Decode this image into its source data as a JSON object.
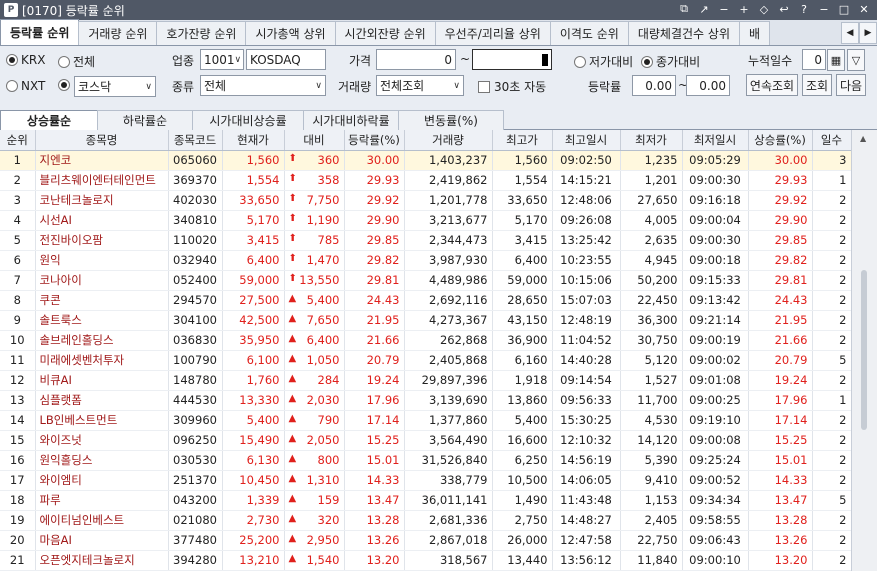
{
  "window": {
    "title": "[0170] 등락률 순위",
    "logo": "P"
  },
  "title_controls": [
    "⧉",
    "↗",
    "−",
    "+",
    "◇",
    "↩",
    "?",
    "−",
    "□",
    "✕"
  ],
  "tabs": [
    {
      "label": "등락률 순위",
      "active": true
    },
    {
      "label": "거래량 순위"
    },
    {
      "label": "호가잔량 순위"
    },
    {
      "label": "시가총액 상위"
    },
    {
      "label": "시간외잔량 순위"
    },
    {
      "label": "우선주/괴리율 상위"
    },
    {
      "label": "이격도 순위"
    },
    {
      "label": "대량체결건수 상위"
    },
    {
      "label": "배"
    }
  ],
  "tab_nav": [
    "◀",
    "▶"
  ],
  "controls": {
    "market_krx": "KRX",
    "market_nxt": "NXT",
    "scope_all": "전체",
    "market_select": "코스닥",
    "sector_label": "업종",
    "sector_code": "1001",
    "sector_name": "KOSDAQ",
    "type_label": "종류",
    "type_value": "전체",
    "price_label": "가격",
    "price_from": "0",
    "tilde": "~",
    "volume_label": "거래량",
    "volume_value": "전체조회",
    "auto30": "30초 자동",
    "vs_low": "저가대비",
    "vs_close": "종가대비",
    "rate_label": "등락률",
    "rate_from": "0.00",
    "rate_to": "0.00",
    "days_label": "누적일수",
    "days_value": "0",
    "btn_continuous": "연속조회",
    "btn_query": "조회",
    "btn_next": "다음"
  },
  "subtabs": [
    "상승률순",
    "하락률순",
    "시가대비상승률",
    "시가대비하락률",
    "변동률(%)"
  ],
  "columns": [
    "순위",
    "종목명",
    "종목코드",
    "현재가",
    "대비",
    "등락률(%)",
    "거래량",
    "최고가",
    "최고일시",
    "최저가",
    "최저일시",
    "상승률(%)",
    "일수"
  ],
  "rows": [
    {
      "rank": "1",
      "name": "지엔코",
      "code": "065060",
      "price": "1,560",
      "arrow": "⬆",
      "chg": "360",
      "rate": "30.00",
      "vol": "1,403,237",
      "high": "1,560",
      "hight": "09:02:50",
      "low": "1,235",
      "lowt": "09:05:29",
      "up": "30.00",
      "days": "3"
    },
    {
      "rank": "2",
      "name": "블리츠웨이엔터테인먼트",
      "code": "369370",
      "price": "1,554",
      "arrow": "⬆",
      "chg": "358",
      "rate": "29.93",
      "vol": "2,419,862",
      "high": "1,554",
      "hight": "14:15:21",
      "low": "1,201",
      "lowt": "09:00:30",
      "up": "29.93",
      "days": "1"
    },
    {
      "rank": "3",
      "name": "코난테크놀로지",
      "code": "402030",
      "price": "33,650",
      "arrow": "⬆",
      "chg": "7,750",
      "rate": "29.92",
      "vol": "1,201,778",
      "high": "33,650",
      "hight": "12:48:06",
      "low": "27,650",
      "lowt": "09:16:18",
      "up": "29.92",
      "days": "2"
    },
    {
      "rank": "4",
      "name": "시선AI",
      "code": "340810",
      "price": "5,170",
      "arrow": "⬆",
      "chg": "1,190",
      "rate": "29.90",
      "vol": "3,213,677",
      "high": "5,170",
      "hight": "09:26:08",
      "low": "4,005",
      "lowt": "09:00:04",
      "up": "29.90",
      "days": "2"
    },
    {
      "rank": "5",
      "name": "전진바이오팜",
      "code": "110020",
      "price": "3,415",
      "arrow": "⬆",
      "chg": "785",
      "rate": "29.85",
      "vol": "2,344,473",
      "high": "3,415",
      "hight": "13:25:42",
      "low": "2,635",
      "lowt": "09:00:30",
      "up": "29.85",
      "days": "2"
    },
    {
      "rank": "6",
      "name": "원익",
      "code": "032940",
      "price": "6,400",
      "arrow": "⬆",
      "chg": "1,470",
      "rate": "29.82",
      "vol": "3,987,930",
      "high": "6,400",
      "hight": "10:23:55",
      "low": "4,945",
      "lowt": "09:00:18",
      "up": "29.82",
      "days": "2"
    },
    {
      "rank": "7",
      "name": "코나아이",
      "code": "052400",
      "price": "59,000",
      "arrow": "⬆",
      "chg": "13,550",
      "rate": "29.81",
      "vol": "4,489,986",
      "high": "59,000",
      "hight": "10:15:06",
      "low": "50,200",
      "lowt": "09:15:33",
      "up": "29.81",
      "days": "2"
    },
    {
      "rank": "8",
      "name": "쿠콘",
      "code": "294570",
      "price": "27,500",
      "arrow": "▲",
      "chg": "5,400",
      "rate": "24.43",
      "vol": "2,692,116",
      "high": "28,650",
      "hight": "15:07:03",
      "low": "22,450",
      "lowt": "09:13:42",
      "up": "24.43",
      "days": "2"
    },
    {
      "rank": "9",
      "name": "솔트룩스",
      "code": "304100",
      "price": "42,500",
      "arrow": "▲",
      "chg": "7,650",
      "rate": "21.95",
      "vol": "4,273,367",
      "high": "43,150",
      "hight": "12:48:19",
      "low": "36,300",
      "lowt": "09:21:14",
      "up": "21.95",
      "days": "2"
    },
    {
      "rank": "10",
      "name": "솔브레인홀딩스",
      "code": "036830",
      "price": "35,950",
      "arrow": "▲",
      "chg": "6,400",
      "rate": "21.66",
      "vol": "262,868",
      "high": "36,900",
      "hight": "11:04:52",
      "low": "30,750",
      "lowt": "09:00:19",
      "up": "21.66",
      "days": "2"
    },
    {
      "rank": "11",
      "name": "미래에셋벤처투자",
      "code": "100790",
      "price": "6,100",
      "arrow": "▲",
      "chg": "1,050",
      "rate": "20.79",
      "vol": "2,405,868",
      "high": "6,160",
      "hight": "14:40:28",
      "low": "5,120",
      "lowt": "09:00:02",
      "up": "20.79",
      "days": "5"
    },
    {
      "rank": "12",
      "name": "비큐AI",
      "code": "148780",
      "price": "1,760",
      "arrow": "▲",
      "chg": "284",
      "rate": "19.24",
      "vol": "29,897,396",
      "high": "1,918",
      "hight": "09:14:54",
      "low": "1,527",
      "lowt": "09:01:08",
      "up": "19.24",
      "days": "2"
    },
    {
      "rank": "13",
      "name": "심플랫폼",
      "code": "444530",
      "price": "13,330",
      "arrow": "▲",
      "chg": "2,030",
      "rate": "17.96",
      "vol": "3,139,690",
      "high": "13,860",
      "hight": "09:56:33",
      "low": "11,700",
      "lowt": "09:00:25",
      "up": "17.96",
      "days": "1"
    },
    {
      "rank": "14",
      "name": "LB인베스트먼트",
      "code": "309960",
      "price": "5,400",
      "arrow": "▲",
      "chg": "790",
      "rate": "17.14",
      "vol": "1,377,860",
      "high": "5,400",
      "hight": "15:30:25",
      "low": "4,530",
      "lowt": "09:19:10",
      "up": "17.14",
      "days": "2"
    },
    {
      "rank": "15",
      "name": "와이즈넛",
      "code": "096250",
      "price": "15,490",
      "arrow": "▲",
      "chg": "2,050",
      "rate": "15.25",
      "vol": "3,564,490",
      "high": "16,600",
      "hight": "12:10:32",
      "low": "14,120",
      "lowt": "09:00:08",
      "up": "15.25",
      "days": "2"
    },
    {
      "rank": "16",
      "name": "원익홀딩스",
      "code": "030530",
      "price": "6,130",
      "arrow": "▲",
      "chg": "800",
      "rate": "15.01",
      "vol": "31,526,840",
      "high": "6,250",
      "hight": "14:56:19",
      "low": "5,390",
      "lowt": "09:25:24",
      "up": "15.01",
      "days": "2"
    },
    {
      "rank": "17",
      "name": "와이엠티",
      "code": "251370",
      "price": "10,450",
      "arrow": "▲",
      "chg": "1,310",
      "rate": "14.33",
      "vol": "338,779",
      "high": "10,500",
      "hight": "14:06:05",
      "low": "9,410",
      "lowt": "09:00:52",
      "up": "14.33",
      "days": "2"
    },
    {
      "rank": "18",
      "name": "파루",
      "code": "043200",
      "price": "1,339",
      "arrow": "▲",
      "chg": "159",
      "rate": "13.47",
      "vol": "36,011,141",
      "high": "1,490",
      "hight": "11:43:48",
      "low": "1,153",
      "lowt": "09:34:34",
      "up": "13.47",
      "days": "5"
    },
    {
      "rank": "19",
      "name": "에이티넘인베스트",
      "code": "021080",
      "price": "2,730",
      "arrow": "▲",
      "chg": "320",
      "rate": "13.28",
      "vol": "2,681,336",
      "high": "2,750",
      "hight": "14:48:27",
      "low": "2,405",
      "lowt": "09:58:55",
      "up": "13.28",
      "days": "2"
    },
    {
      "rank": "20",
      "name": "마음AI",
      "code": "377480",
      "price": "25,200",
      "arrow": "▲",
      "chg": "2,950",
      "rate": "13.26",
      "vol": "2,867,018",
      "high": "26,000",
      "hight": "12:47:58",
      "low": "22,750",
      "lowt": "09:06:43",
      "up": "13.26",
      "days": "2"
    },
    {
      "rank": "21",
      "name": "오픈엣지테크놀로지",
      "code": "394280",
      "price": "13,210",
      "arrow": "▲",
      "chg": "1,540",
      "rate": "13.20",
      "vol": "318,567",
      "high": "13,440",
      "hight": "13:56:12",
      "low": "11,840",
      "lowt": "09:00:10",
      "up": "13.20",
      "days": "2"
    }
  ]
}
